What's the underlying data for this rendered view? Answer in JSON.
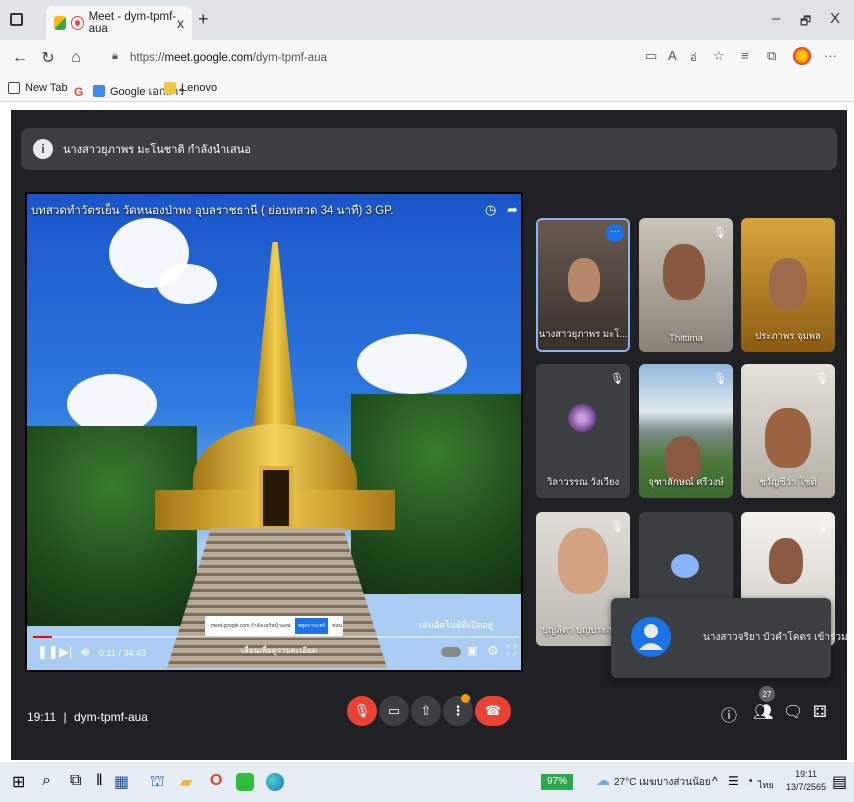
{
  "browser": {
    "tab_title": "Meet - dym-tpmf-aua",
    "tab_close": "x",
    "new_tab": "+",
    "url_prefix": "https://",
    "url_host": "meet.google.com",
    "url_path": "/dym-tpmf-aua",
    "minimize": "–",
    "restore": "🗗",
    "close": "X",
    "bookmarks": [
      {
        "label": "New Tab"
      },
      {
        "label": "Google เอกสาร"
      },
      {
        "label": "Lenovo"
      }
    ]
  },
  "meet": {
    "presenter_text": "นางสาวยุภาพร มะโนชาติ กำลังนำเสนอ",
    "video": {
      "title": "บทสวดทำวัตรเย็น วัดหนองป่าพง อุบลราชธานี ( ย่อบทสวด 34 นาที) 3 GP.",
      "time": "0:11 / 34:43",
      "progress": 0.04,
      "auto_subtitle": "เล่นอัตโนมัติเปิดอยู่",
      "toast_text": "meet.google.com กำลังแชร์หน้าจอของคุณ",
      "toast_stop": "หยุดการแชร์",
      "toast_hide": "ซ่อน",
      "more_info": "เลื่อนเพื่อดูรายละเอียด"
    },
    "tiles": [
      {
        "name": "นางสาวยุภาพร มะโ...",
        "muted": false,
        "active": true
      },
      {
        "name": "Thittima",
        "muted": true
      },
      {
        "name": "ประภาพร จุมพล",
        "muted": false
      },
      {
        "name": "วิลาวรรณ วังเวียง",
        "muted": true
      },
      {
        "name": "จุฑาลักษณ์ ศรีวงษ์",
        "muted": true
      },
      {
        "name": "ชวัญชีวา โชติ",
        "muted": true
      },
      {
        "name": "บุญลิตา บุญประสาน",
        "muted": true
      },
      {
        "name": "",
        "muted": false
      },
      {
        "name": "",
        "muted": true
      }
    ],
    "popup_text": "นางสาวจริยา บัวคำโคตร เข้าร่วม",
    "clock": "19:11",
    "meeting_code": "dym-tpmf-aua",
    "separator": "|",
    "participant_count": "27",
    "colors": {
      "background": "#202124",
      "tile": "#3c4043",
      "end_call": "#ea4335"
    }
  },
  "taskbar": {
    "battery": "97%",
    "weather": "27°C เมฆบางส่วนน้อย",
    "lang": "ไทย",
    "time": "19:11",
    "date": "13/7/2565"
  }
}
